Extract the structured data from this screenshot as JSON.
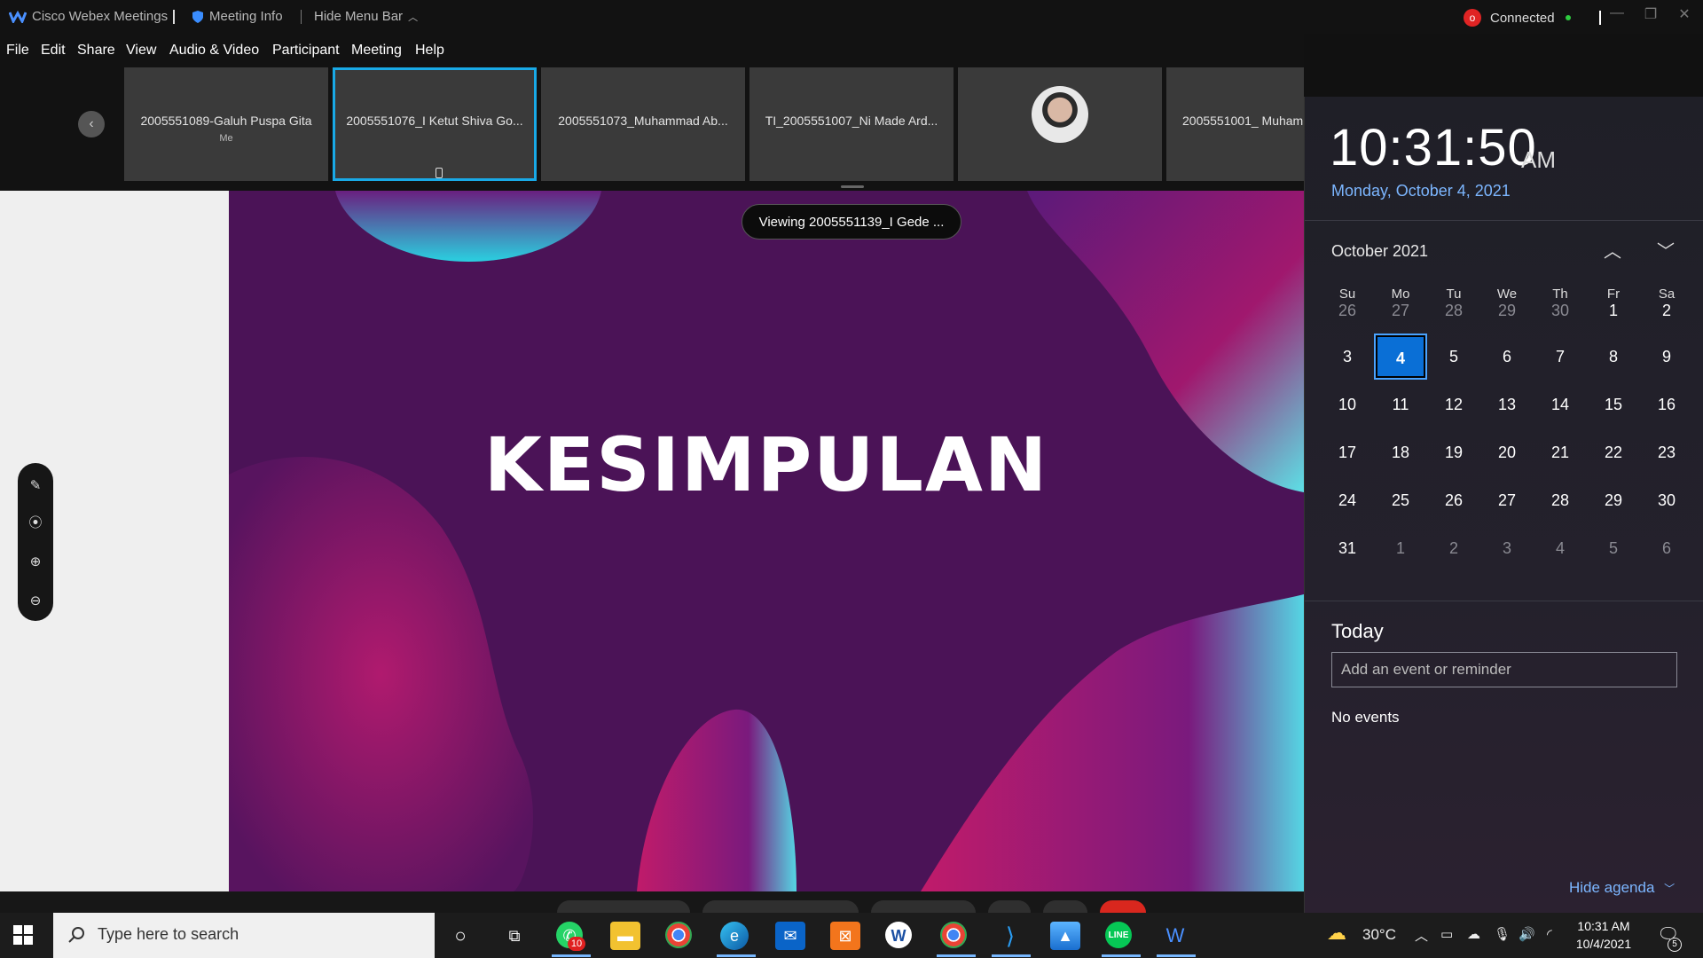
{
  "titlebar": {
    "app_name": "Cisco Webex Meetings",
    "meeting_info": "Meeting Info",
    "hide_menu_bar": "Hide Menu Bar",
    "status": "Connected",
    "recording_indicator": "o"
  },
  "menubar": {
    "items": [
      "File",
      "Edit",
      "Share",
      "View",
      "Audio & Video",
      "Participant",
      "Meeting",
      "Help"
    ]
  },
  "participants": [
    {
      "name": "2005551089-Galuh Puspa Gita",
      "sub": "Me"
    },
    {
      "name": "2005551076_I Ketut Shiva Go...",
      "sub": ""
    },
    {
      "name": "2005551073_Muhammad Ab...",
      "sub": ""
    },
    {
      "name": "TI_2005551007_Ni Made Ard...",
      "sub": ""
    },
    {
      "name": "",
      "sub": ""
    },
    {
      "name": "2005551001_ Muham",
      "sub": ""
    }
  ],
  "viewing_label": "Viewing 2005551139_I Gede ...",
  "slide": {
    "title": "KESIMPULAN"
  },
  "annotation_tools": [
    "annotate-icon",
    "laser-pointer-icon",
    "zoom-in-icon",
    "zoom-out-icon"
  ],
  "calendar": {
    "time": "10:31:50",
    "ampm": "AM",
    "date_long": "Monday, October 4, 2021",
    "month_title": "October 2021",
    "weekdays": [
      "Su",
      "Mo",
      "Tu",
      "We",
      "Th",
      "Fr",
      "Sa"
    ],
    "days": [
      [
        "26",
        "27",
        "28",
        "29",
        "30",
        "1",
        "2"
      ],
      [
        "3",
        "4",
        "5",
        "6",
        "7",
        "8",
        "9"
      ],
      [
        "10",
        "11",
        "12",
        "13",
        "14",
        "15",
        "16"
      ],
      [
        "17",
        "18",
        "19",
        "20",
        "21",
        "22",
        "23"
      ],
      [
        "24",
        "25",
        "26",
        "27",
        "28",
        "29",
        "30"
      ],
      [
        "31",
        "1",
        "2",
        "3",
        "4",
        "5",
        "6"
      ]
    ],
    "today": "4",
    "today_label": "Today",
    "event_placeholder": "Add an event or reminder",
    "no_events": "No events",
    "hide_agenda": "Hide agenda"
  },
  "taskbar": {
    "search_placeholder": "Type here to search",
    "whatsapp_badge": "10",
    "temperature": "30°C",
    "clock_time": "10:31 AM",
    "clock_date": "10/4/2021",
    "notification_count": "5"
  },
  "colors": {
    "accent": "#19a9e6",
    "slide_bg": "#4b1357",
    "link": "#7cb6ff"
  }
}
